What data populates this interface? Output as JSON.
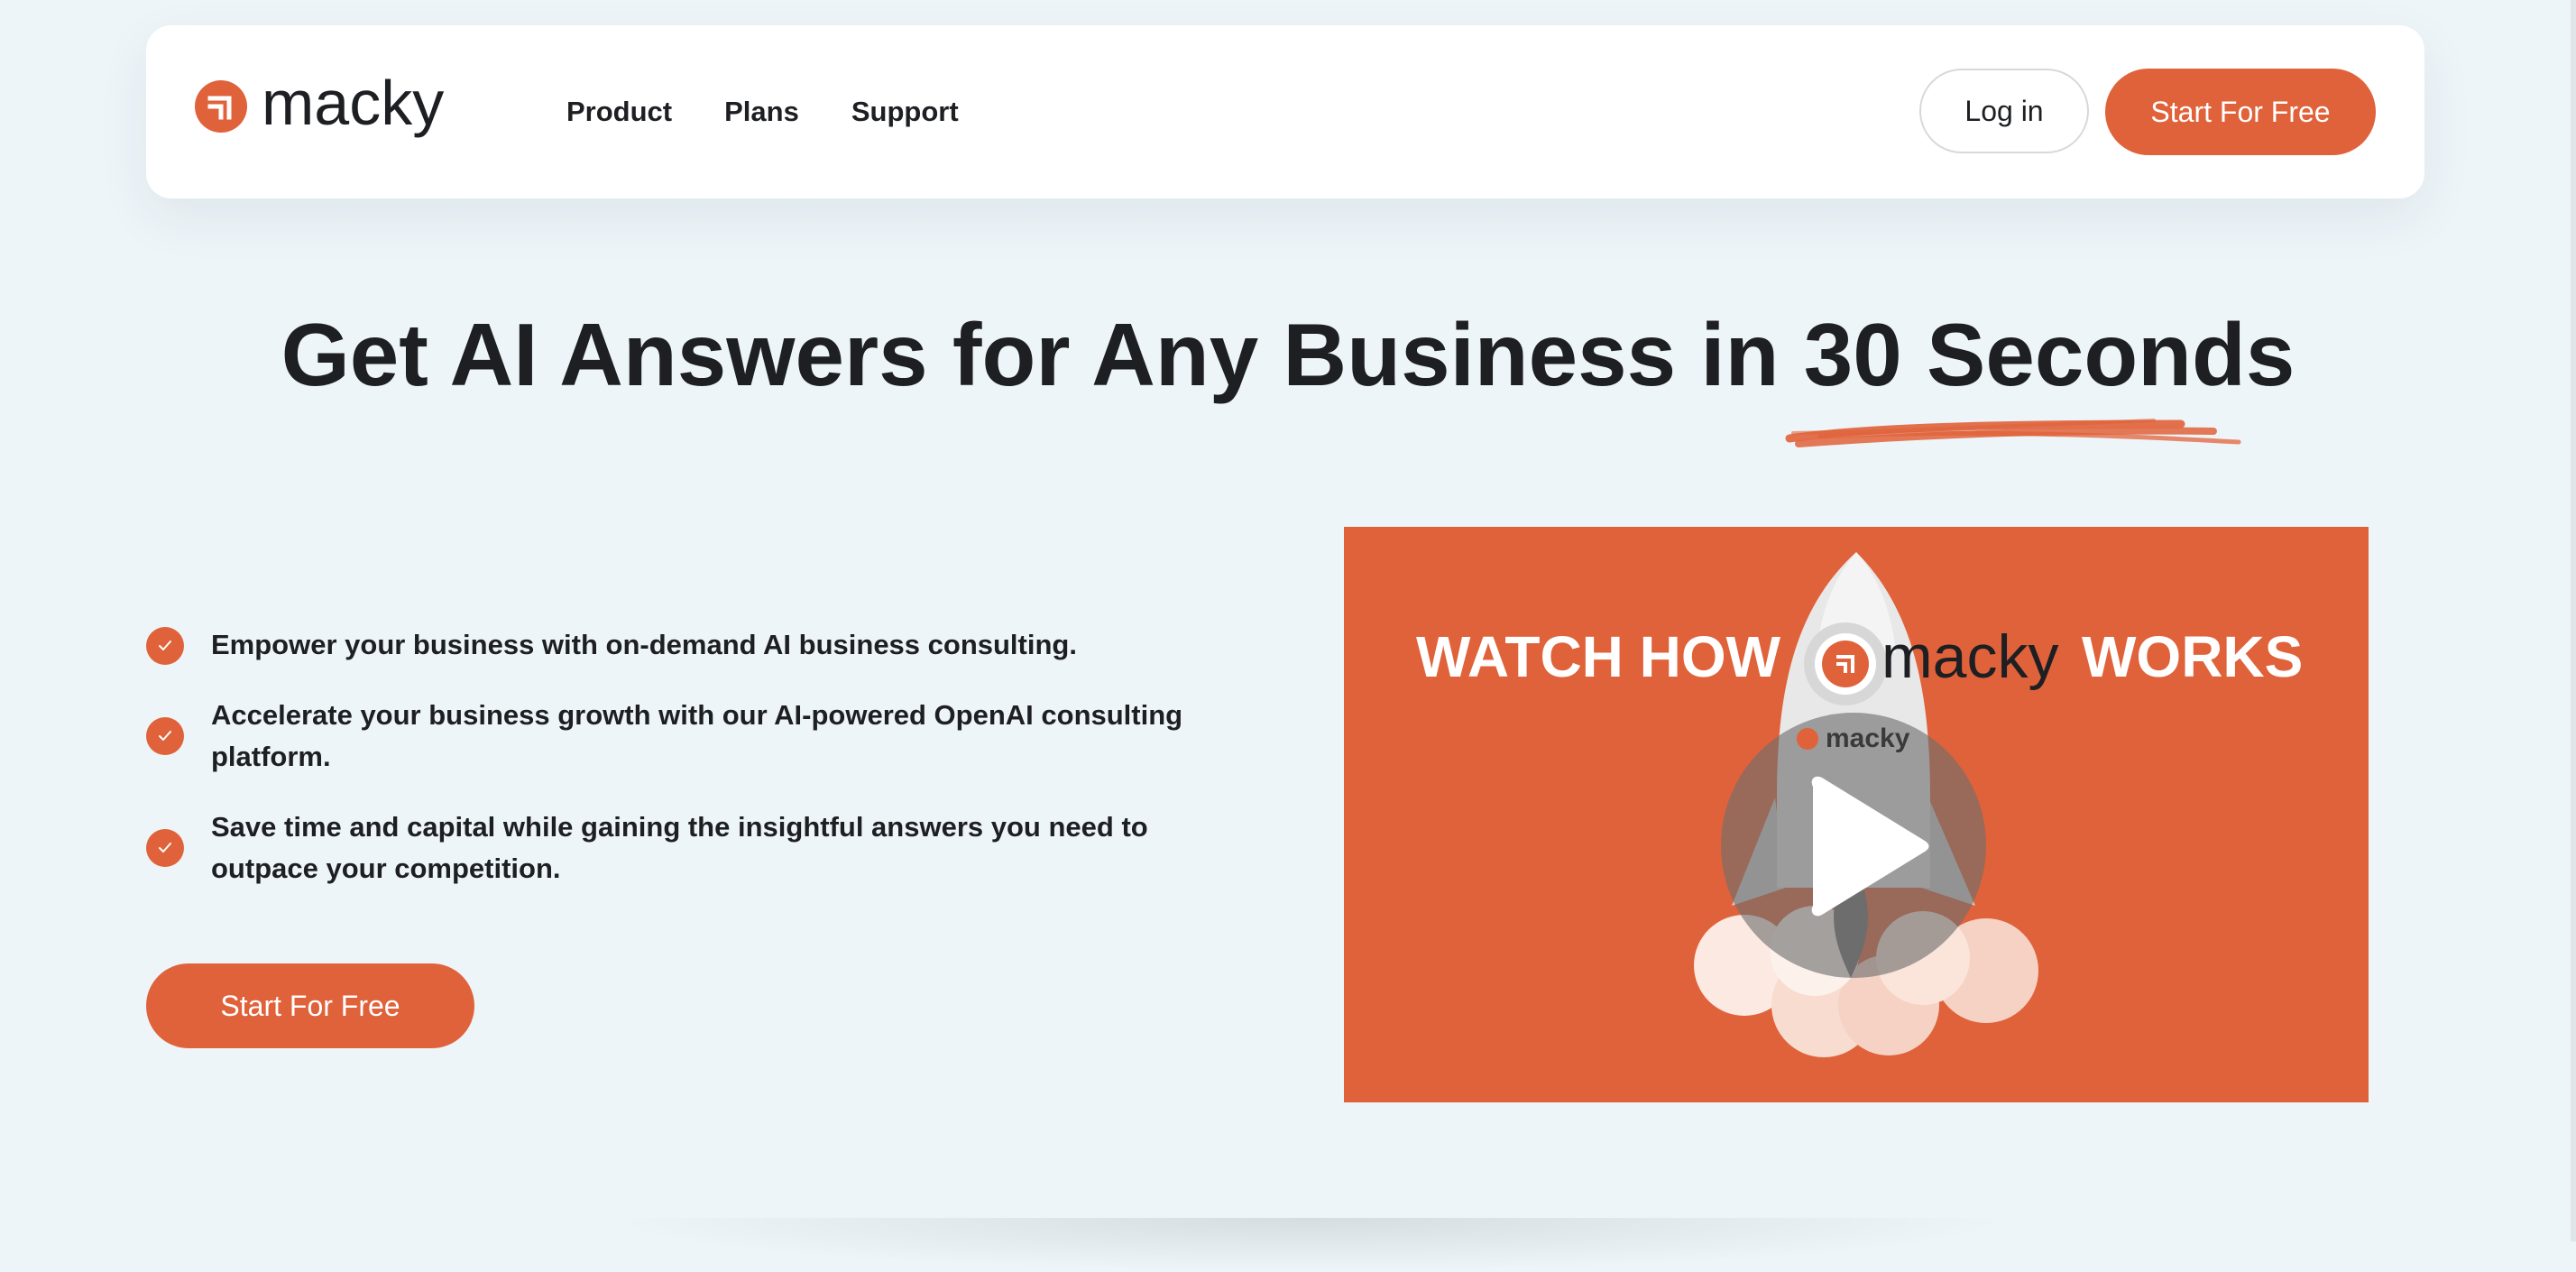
{
  "colors": {
    "brand": "#e0623a",
    "background": "#eef5f9",
    "text": "#1d1f22"
  },
  "brand": {
    "name": "macky",
    "logo_icon": "macky-logo-icon"
  },
  "nav": {
    "links": [
      "Product",
      "Plans",
      "Support"
    ],
    "login_label": "Log in",
    "start_label": "Start For Free"
  },
  "hero": {
    "headline": "Get AI Answers for Any Business in 30 Seconds",
    "features": [
      "Empower your business with on-demand AI business consulting.",
      "Accelerate your business growth with our AI-powered OpenAI consulting platform.",
      "Save time and capital while gaining the insightful answers you need to outpace your competition."
    ],
    "check_icon": "check-icon",
    "cta_label": "Start For Free"
  },
  "video": {
    "title_left": "WATCH HOW",
    "title_brand": "macky",
    "title_right": "WORKS",
    "mini_brand": "macky",
    "play_icon": "play-icon",
    "illustration": "rocket-illustration"
  }
}
